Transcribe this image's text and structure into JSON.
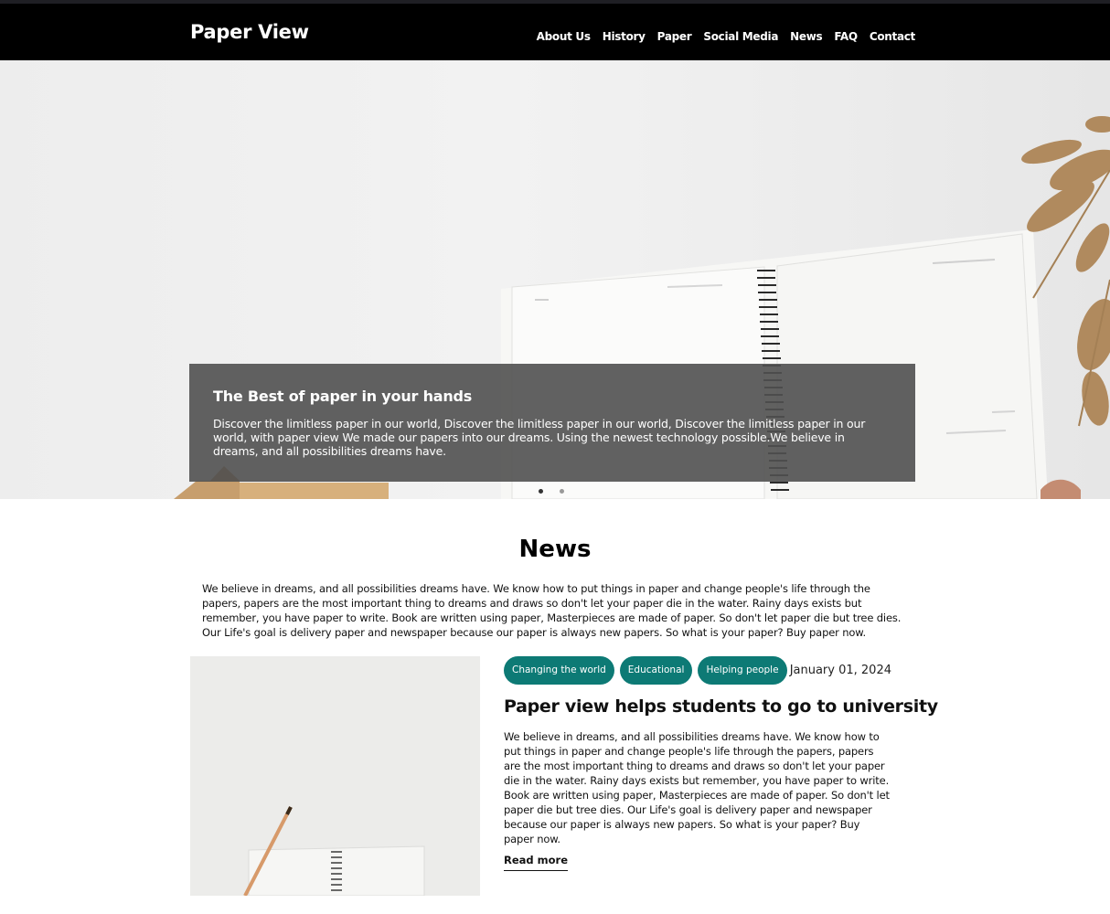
{
  "header": {
    "brand": "Paper View",
    "nav": [
      "About Us",
      "History",
      "Paper",
      "Social Media",
      "News",
      "FAQ",
      "Contact"
    ]
  },
  "hero": {
    "title": "The Best of paper in your hands",
    "text": "Discover the limitless paper in our world, Discover the limitless paper in our world, Discover the limitless paper in our world, with paper view We made our papers into our dreams. Using the newest technology possible.We believe in dreams, and all possibilities dreams have.",
    "slides_total": 2,
    "active_slide": 1
  },
  "news": {
    "title": "News",
    "intro": "We believe in dreams, and all possibilities dreams have. We know how to put things in paper and change people's life through the papers, papers are the most important thing to dreams and draws so don't let your paper die in the water. Rainy days exists but remember, you have paper to write. Book are written using paper, Masterpieces are made of paper. So don't let paper die but tree dies. Our Life's goal is delivery paper and newspaper because our paper is always new papers. So what is your paper? Buy paper now.",
    "article": {
      "tags": [
        "Changing the world",
        "Educational",
        "Helping people"
      ],
      "date": "January 01, 2024",
      "title": "Paper view helps students to go to university",
      "text": "We believe in dreams, and all possibilities dreams have. We know how to put things in paper and change people's life through the papers, papers are the most important thing to dreams and draws so don't let your paper die in the water. Rainy days exists but remember, you have paper to write. Book are written using paper, Masterpieces are made of paper. So don't let paper die but tree dies. Our Life's goal is delivery paper and newspaper because our paper is always new papers. So what is your paper? Buy paper now.",
      "read_more": "Read more"
    }
  },
  "colors": {
    "navbar": "#000000",
    "tag": "#0d7a75",
    "caption_overlay": "#505050"
  }
}
